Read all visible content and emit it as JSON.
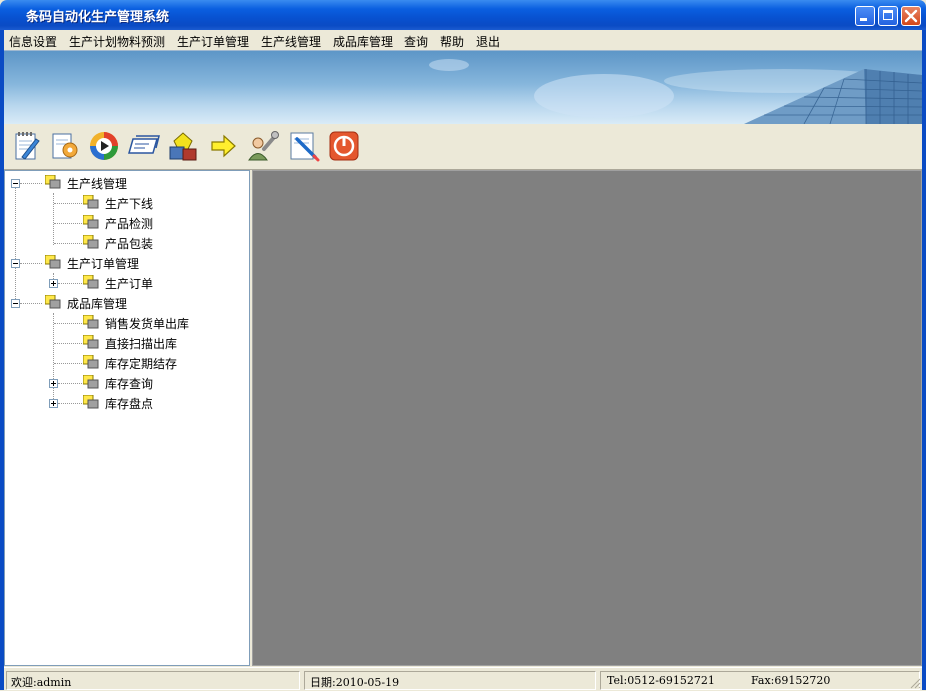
{
  "window": {
    "title": "条码自动化生产管理系统"
  },
  "menu": [
    "信息设置",
    "生产计划物料预测",
    "生产订单管理",
    "生产线管理",
    "成品库管理",
    "查询",
    "帮助",
    "退出"
  ],
  "toolbar": [
    {
      "name": "notepad-icon"
    },
    {
      "name": "settings-document-icon"
    },
    {
      "name": "media-play-icon"
    },
    {
      "name": "cards-icon"
    },
    {
      "name": "shapes-icon"
    },
    {
      "name": "arrow-right-icon"
    },
    {
      "name": "user-tools-icon"
    },
    {
      "name": "pencil-document-icon"
    },
    {
      "name": "power-icon"
    }
  ],
  "tree": [
    {
      "label": "生产线管理",
      "level": 0,
      "expander": "minus"
    },
    {
      "label": "生产下线",
      "level": 1,
      "expander": ""
    },
    {
      "label": "产品检测",
      "level": 1,
      "expander": ""
    },
    {
      "label": "产品包装",
      "level": 1,
      "expander": ""
    },
    {
      "label": "生产订单管理",
      "level": 0,
      "expander": "minus"
    },
    {
      "label": "生产订单",
      "level": 1,
      "expander": "plus"
    },
    {
      "label": "成品库管理",
      "level": 0,
      "expander": "minus"
    },
    {
      "label": "销售发货单出库",
      "level": 1,
      "expander": ""
    },
    {
      "label": "直接扫描出库",
      "level": 1,
      "expander": ""
    },
    {
      "label": "库存定期结存",
      "level": 1,
      "expander": ""
    },
    {
      "label": "库存查询",
      "level": 1,
      "expander": "plus"
    },
    {
      "label": "库存盘点",
      "level": 1,
      "expander": "plus"
    }
  ],
  "status": {
    "welcome": "欢迎:admin",
    "date": "日期:2010-05-19",
    "tel": "Tel:0512-69152721",
    "fax": "Fax:69152720"
  }
}
